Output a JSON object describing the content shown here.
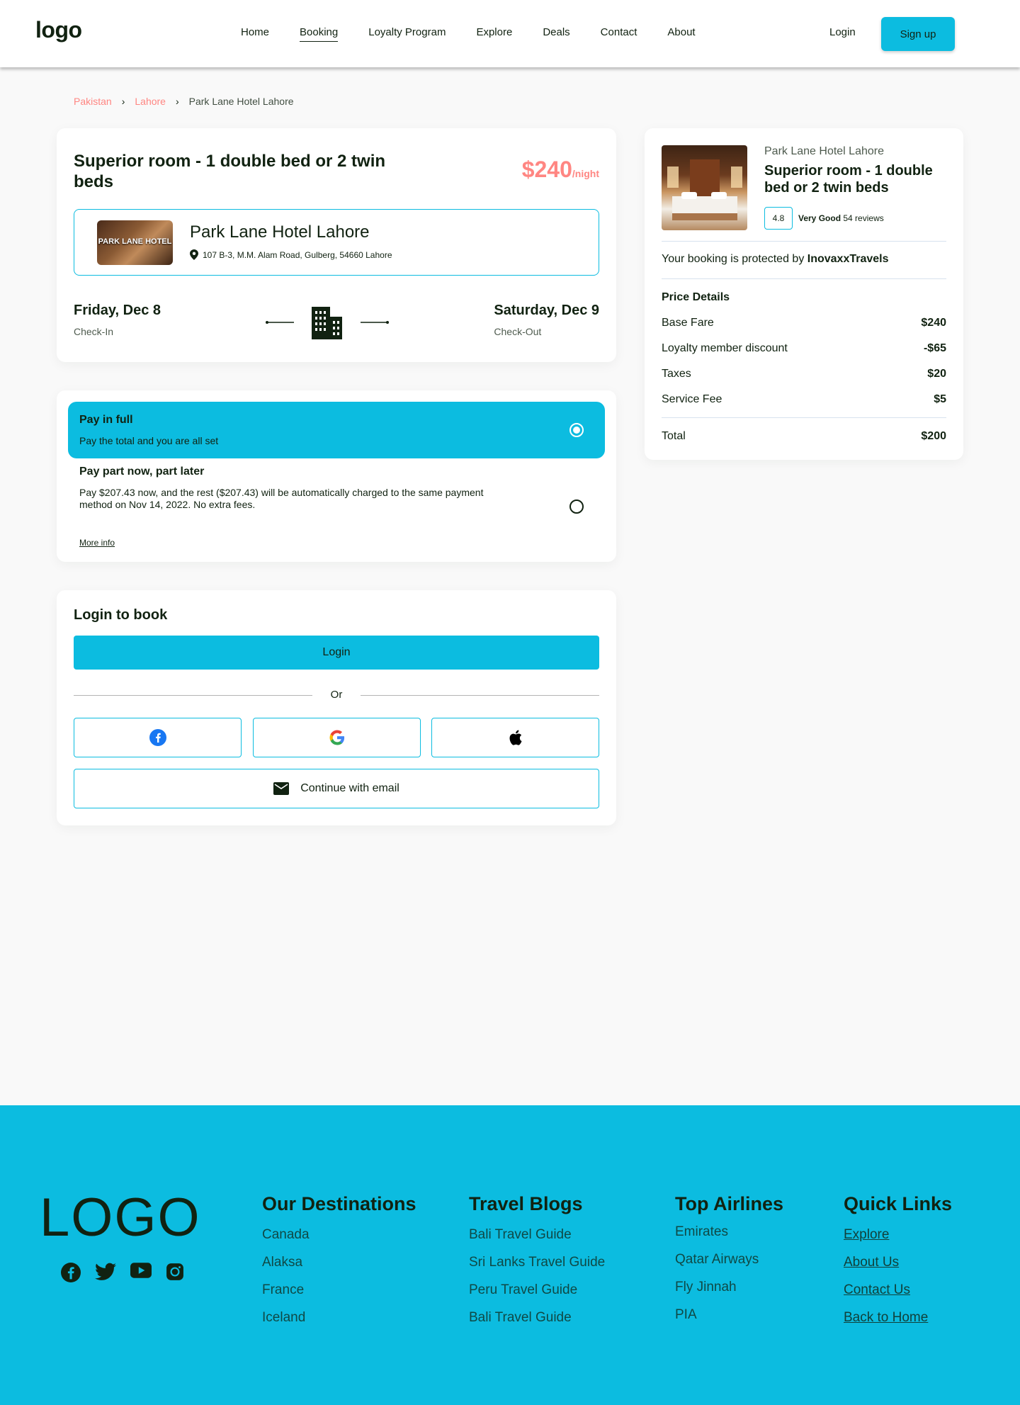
{
  "header": {
    "logo": "logo",
    "nav": [
      "Home",
      "Booking",
      "Loyalty Program",
      "Explore",
      "Deals",
      "Contact",
      "About"
    ],
    "active_nav": "Booking",
    "login": "Login",
    "signup": "Sign up"
  },
  "breadcrumb": [
    "Pakistan",
    "Lahore",
    "Park Lane Hotel Lahore"
  ],
  "room": {
    "title": "Superior room - 1 double bed or 2 twin beds",
    "price": "$240",
    "price_unit": "/night",
    "hotel_image_text": "PARK LANE HOTEL",
    "hotel_name": "Park Lane Hotel Lahore",
    "address": "107 B-3, M.M. Alam Road, Gulberg, 54660 Lahore",
    "checkin_date": "Friday, Dec 8",
    "checkin_label": "Check-In",
    "checkout_date": "Saturday, Dec 9",
    "checkout_label": "Check-Out"
  },
  "payment": {
    "options": [
      {
        "title": "Pay in full",
        "subtitle": "Pay the total and you are all set",
        "selected": true
      },
      {
        "title": "Pay part now, part later",
        "subtitle": "Pay $207.43 now, and the rest ($207.43) will be automatically charged to the same payment method on Nov 14, 2022. No extra fees.",
        "selected": false
      }
    ],
    "more_info": "More info"
  },
  "login_box": {
    "title": "Login to book",
    "login_button": "Login",
    "or": "Or",
    "social": [
      "facebook-icon",
      "google-icon",
      "apple-icon"
    ],
    "email_button": "Continue with email"
  },
  "summary": {
    "hotel": "Park Lane Hotel Lahore",
    "room": "Superior room - 1 double bed or 2 twin beds",
    "rating": "4.8",
    "rating_label": "Very Good",
    "reviews": "54 reviews",
    "protected_prefix": "Your booking is protected by ",
    "protected_brand": "InovaxxTravels",
    "price_title": "Price Details",
    "rows": [
      {
        "label": "Base Fare",
        "value": "$240"
      },
      {
        "label": "Loyalty member discount",
        "value": "-$65"
      },
      {
        "label": "Taxes",
        "value": "$20"
      },
      {
        "label": "Service Fee",
        "value": "$5"
      }
    ],
    "total_label": "Total",
    "total_value": "$200"
  },
  "footer": {
    "logo": "LOGO",
    "social": [
      "facebook-icon",
      "twitter-icon",
      "youtube-icon",
      "instagram-icon"
    ],
    "columns": [
      {
        "title": "Our Destinations",
        "items": [
          "Canada",
          "Alaksa",
          "France",
          "Iceland"
        ]
      },
      {
        "title": "Travel Blogs",
        "items": [
          "Bali Travel Guide",
          "Sri Lanks Travel Guide",
          "Peru Travel Guide",
          "Bali Travel Guide"
        ]
      },
      {
        "title": "Top Airlines",
        "items": [
          "Emirates",
          "Qatar Airways",
          "Fly Jinnah",
          "PIA"
        ]
      },
      {
        "title": "Quick Links",
        "items": [
          "Explore",
          "About Us",
          "Contact Us",
          "Back to Home"
        ]
      }
    ]
  },
  "colors": {
    "accent": "#0cbce0",
    "price": "#ff8682",
    "text": "#112211",
    "background": "#f9f9f9"
  }
}
